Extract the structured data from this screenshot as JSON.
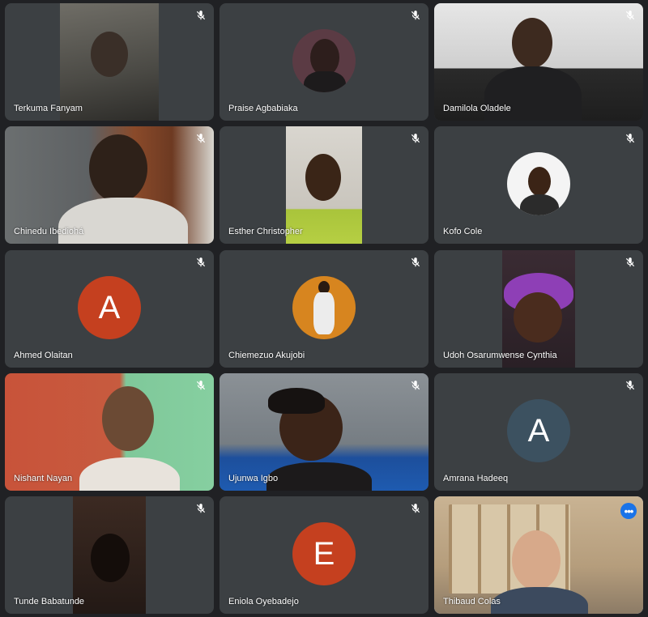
{
  "participants": [
    {
      "name": "Terkuma Fanyam",
      "muted": true
    },
    {
      "name": "Praise Agbabiaka",
      "muted": true
    },
    {
      "name": "Damilola Oladele",
      "muted": true
    },
    {
      "name": "Chinedu Ibediohá",
      "muted": true
    },
    {
      "name": "Esther Christopher",
      "muted": true
    },
    {
      "name": "Kofo Cole",
      "muted": true
    },
    {
      "name": "Ahmed Olaitan",
      "muted": true,
      "avatar_letter": "A",
      "avatar_color": "#c5401f"
    },
    {
      "name": "Chiemezuo Akujobi",
      "muted": true
    },
    {
      "name": "Udoh Osarumwense Cynthia",
      "muted": true
    },
    {
      "name": "Nishant Nayan",
      "muted": true
    },
    {
      "name": "Ujunwa Igbo",
      "muted": true
    },
    {
      "name": "Amrana Hadeeq",
      "muted": true,
      "avatar_letter": "A",
      "avatar_color": "#3c5160"
    },
    {
      "name": "Tunde Babatunde",
      "muted": true
    },
    {
      "name": "Eniola Oyebadejo",
      "muted": true,
      "avatar_letter": "E",
      "avatar_color": "#c5401f"
    },
    {
      "name": "Thibaud Colas",
      "muted": false,
      "active": true
    }
  ],
  "icons": {
    "muted": "mic-off-icon",
    "more": "more-options-icon"
  },
  "more_label": "•••",
  "colors": {
    "tile_bg": "#3c4043",
    "page_bg": "#202124",
    "active_border": "#8ab4f8",
    "more_button": "#1a73e8"
  }
}
